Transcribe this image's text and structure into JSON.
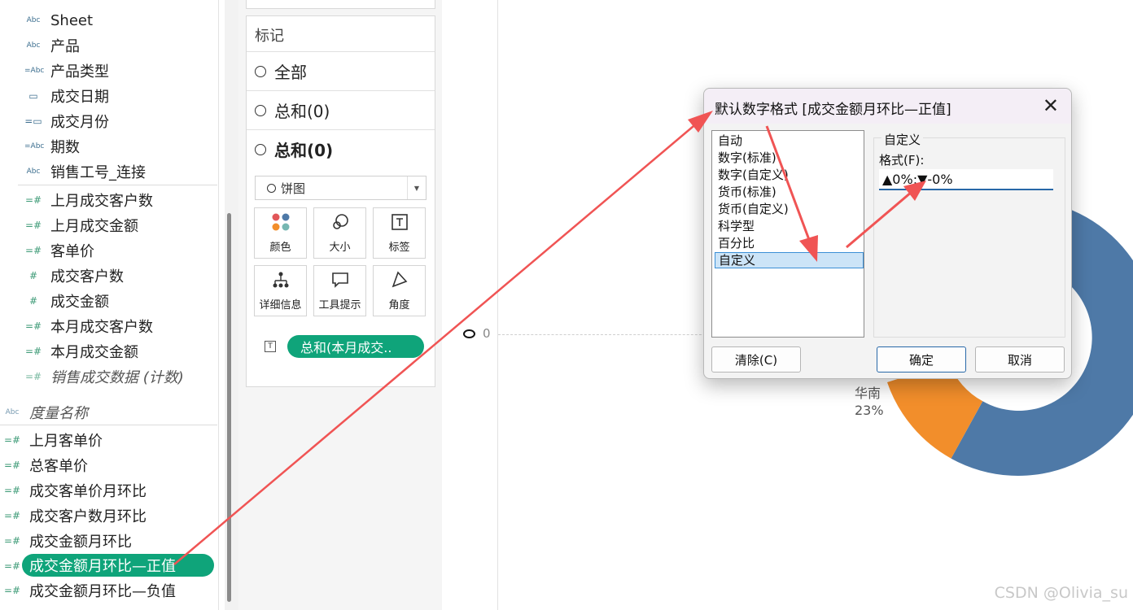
{
  "data_pane": {
    "dimensions": [
      {
        "label": "Sheet",
        "icon": "Abc"
      },
      {
        "label": "产品",
        "icon": "Abc"
      },
      {
        "label": "产品类型",
        "icon": "=Abc"
      },
      {
        "label": "成交日期",
        "icon": "calendar"
      },
      {
        "label": "成交月份",
        "icon": "calendar-calc"
      },
      {
        "label": "期数",
        "icon": "=Abc"
      },
      {
        "label": "销售工号_连接",
        "icon": "Abc"
      }
    ],
    "measures": [
      {
        "label": "上月成交客户数",
        "icon": "=#"
      },
      {
        "label": "上月成交金额",
        "icon": "=#"
      },
      {
        "label": "客单价",
        "icon": "=#"
      },
      {
        "label": "成交客户数",
        "icon": "#"
      },
      {
        "label": "成交金额",
        "icon": "#"
      },
      {
        "label": "本月成交客户数",
        "icon": "=#"
      },
      {
        "label": "本月成交金额",
        "icon": "=#"
      },
      {
        "label": "销售成交数据 (计数)",
        "icon": "=#"
      }
    ],
    "measure_names": {
      "label": "度量名称",
      "icon": "Abc"
    },
    "calc_fields": [
      {
        "label": "上月客单价",
        "icon": "=#"
      },
      {
        "label": "总客单价",
        "icon": "=#"
      },
      {
        "label": "成交客单价月环比",
        "icon": "=#"
      },
      {
        "label": "成交客户数月环比",
        "icon": "=#"
      },
      {
        "label": "成交金额月环比",
        "icon": "=#"
      },
      {
        "label": "成交金额月环比—正值",
        "icon": "=#",
        "selected": true
      },
      {
        "label": "成交金额月环比—负值",
        "icon": "=#"
      }
    ]
  },
  "marks": {
    "title": "标记",
    "tabs": [
      "全部",
      "总和(0)",
      "总和(0)"
    ],
    "mark_type": "饼图",
    "buttons": [
      "颜色",
      "大小",
      "标签",
      "详细信息",
      "工具提示",
      "角度"
    ],
    "pill": "总和(本月成交.."
  },
  "view": {
    "axis_zero": "0",
    "slice_label_name": "华南",
    "slice_label_pct": "23%",
    "watermark": "CSDN @Olivia_su"
  },
  "dialog": {
    "title": "默认数字格式 [成交金额月环比—正值]",
    "close": "✕",
    "formats": [
      "自动",
      "数字(标准)",
      "数字(自定义)",
      "货币(标准)",
      "货币(自定义)",
      "科学型",
      "百分比",
      "自定义"
    ],
    "selected_format": "自定义",
    "custom_group": "自定义",
    "format_label": "格式(F):",
    "format_value": "▲0%;▼-0%",
    "clear_button": "清除(C)",
    "ok_button": "确定",
    "cancel_button": "取消"
  },
  "colors": {
    "accent_green": "#0fa47a",
    "donut_blue": "#4e79a7",
    "donut_orange": "#f28e2b",
    "arrow_red": "#f05454"
  }
}
